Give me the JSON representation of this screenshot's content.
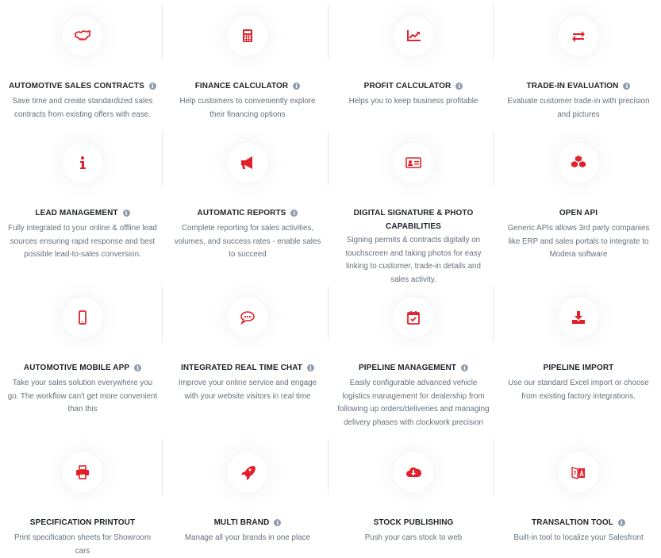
{
  "colors": {
    "accent": "#e3202a",
    "title": "#1f2328",
    "text": "#66707a",
    "info_badge": "#8e9dad"
  },
  "features": [
    {
      "icon": "handshake-icon",
      "title": "AUTOMOTIVE SALES CONTRACTS",
      "info": true,
      "desc": "Save time and create standardized sales contracts from existing offers with ease."
    },
    {
      "icon": "calculator-icon",
      "title": "FINANCE CALCULATOR",
      "info": true,
      "desc": "Help customers to conveniently explore their financing options"
    },
    {
      "icon": "line-chart-icon",
      "title": "PROFIT CALCULATOR",
      "info": true,
      "desc": "Helps you to keep business profitable"
    },
    {
      "icon": "exchange-arrows-icon",
      "title": "TRADE-IN EVALUATION",
      "info": true,
      "desc": "Evaluate customer trade-in with precision and pictures"
    },
    {
      "icon": "info-icon",
      "title": "LEAD MANAGEMENT",
      "info": true,
      "desc": "Fully integrated to your online & offline lead sources ensuring rapid response and best possible lead-to-sales conversion."
    },
    {
      "icon": "megaphone-icon",
      "title": "AUTOMATIC REPORTS",
      "info": true,
      "desc": "Complete reporting for sales activities, volumes, and success rates - enable sales to succeed"
    },
    {
      "icon": "id-card-icon",
      "title": "DIGITAL SIGNATURE & PHOTO CAPABILITIES",
      "info": false,
      "desc": "Signing permits & contracts digitally on touchscreen and taking photos for easy linking to customer, trade-in details and sales activity."
    },
    {
      "icon": "cubes-icon",
      "title": "OPEN API",
      "info": false,
      "desc": "Generic APIs allows 3rd party companies like ERP and sales portals to integrate to Modera software"
    },
    {
      "icon": "mobile-phone-icon",
      "title": "AUTOMOTIVE MOBILE APP",
      "info": true,
      "desc": "Take your sales solution everywhere you go. The workflow can't get more convenient than this"
    },
    {
      "icon": "chat-bubble-icon",
      "title": "INTEGRATED REAL TIME CHAT",
      "info": true,
      "desc": "Improve your online service and engage with your website visitors in real time"
    },
    {
      "icon": "calendar-check-icon",
      "title": "PIPELINE MANAGEMENT",
      "info": true,
      "desc": "Easily configurable advanced vehicle logistics management for dealership from following up orders/deliveries and managing delivery phases with clockwork precision"
    },
    {
      "icon": "download-icon",
      "title": "PIPELINE IMPORT",
      "info": false,
      "desc": "Use our standard Excel import or choose from existing factory integrations."
    },
    {
      "icon": "printer-icon",
      "title": "SPECIFICATION PRINTOUT",
      "info": false,
      "desc": "Print specification sheets for Showroom cars"
    },
    {
      "icon": "rocket-icon",
      "title": "MULTI BRAND",
      "info": true,
      "desc": "Manage all your brands in one place"
    },
    {
      "icon": "cloud-download-icon",
      "title": "STOCK PUBLISHING",
      "info": false,
      "desc": "Push your cars stock to web"
    },
    {
      "icon": "translate-icon",
      "title": "TRANSALTION TOOL",
      "info": true,
      "desc": "Built-in tool to localize your Salesfront"
    }
  ]
}
